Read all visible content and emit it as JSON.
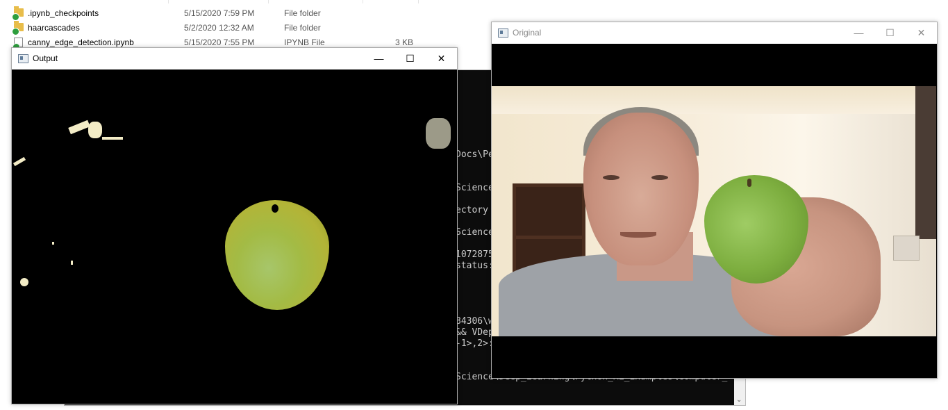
{
  "explorer": {
    "files": [
      {
        "name": ".ipynb_checkpoints",
        "date": "5/15/2020 7:59 PM",
        "type": "File folder",
        "size": "",
        "icon": "folder-icon"
      },
      {
        "name": "haarcascades",
        "date": "5/2/2020 12:32 AM",
        "type": "File folder",
        "size": "",
        "icon": "folder-icon"
      },
      {
        "name": "canny_edge_detection.ipynb",
        "date": "5/15/2020 7:55 PM",
        "type": "IPYNB File",
        "size": "3 KB",
        "icon": "file-icon"
      }
    ]
  },
  "console": {
    "lines": [
      "Docs\\Pe",
      "Science",
      "ectory",
      "Science",
      "1072875",
      "status:",
      "84306\\w",
      "&& VDep",
      "-1>,2>:",
      "Science\\Deep_Learning\\Python_ML_Examples\\Computer_"
    ],
    "scroll_down_glyph": "⌄"
  },
  "output_window": {
    "title": "Output",
    "minimize": "—",
    "maximize": "☐",
    "close": "✕"
  },
  "original_window": {
    "title": "Original",
    "minimize": "—",
    "maximize": "☐",
    "close": "✕"
  }
}
